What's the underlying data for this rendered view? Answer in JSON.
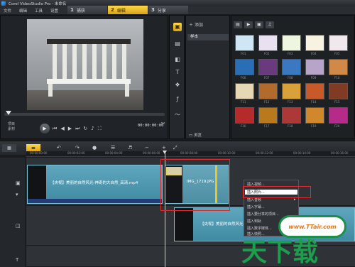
{
  "window": {
    "title": "Corel VideoStudio Pro - 未命名"
  },
  "menu": [
    "文件",
    "编辑",
    "工具",
    "设置"
  ],
  "steps": [
    {
      "num": "1",
      "label": "捕获"
    },
    {
      "num": "2",
      "label": "编辑"
    },
    {
      "num": "3",
      "label": "分享"
    }
  ],
  "player": {
    "project_label": "项目",
    "clip_label": "素材",
    "timecode": "00:00:00:00"
  },
  "library": {
    "add_label": "添加",
    "sample_folder": "样本",
    "browse_label": "浏览",
    "thumbs": [
      {
        "label": "F01",
        "color": "#cfe7f5"
      },
      {
        "label": "F02",
        "color": "#e9e0f0"
      },
      {
        "label": "F03",
        "color": "#eef6df"
      },
      {
        "label": "F04",
        "color": "#f7f3e0"
      },
      {
        "label": "F05",
        "color": "#f0e8ec"
      },
      {
        "label": "F06",
        "color": "#2a6fb5"
      },
      {
        "label": "F07",
        "color": "#6a3a7e"
      },
      {
        "label": "F08",
        "color": "#3a78c2"
      },
      {
        "label": "F09",
        "color": "#b9a4c9"
      },
      {
        "label": "F10",
        "color": "#d1894a"
      },
      {
        "label": "F11",
        "color": "#e7d8b5"
      },
      {
        "label": "F12",
        "color": "#b26b2c"
      },
      {
        "label": "F13",
        "color": "#d9a13a"
      },
      {
        "label": "F14",
        "color": "#c85a2a"
      },
      {
        "label": "F15",
        "color": "#7f3b24"
      },
      {
        "label": "F16",
        "color": "#b52a2a"
      },
      {
        "label": "F17",
        "color": "#b87a1c"
      },
      {
        "label": "F18",
        "color": "#ad3838"
      },
      {
        "label": "F19",
        "color": "#d0882a"
      },
      {
        "label": "F20",
        "color": "#b62a8a"
      }
    ]
  },
  "ruler": [
    "00:00:00:00",
    "00:00:02:00",
    "00:00:04:00",
    "00:00:06:00",
    "00:00:08:00",
    "00:00:10:00",
    "00:00:12:00",
    "00:00:14:00",
    "00:00:16:00"
  ],
  "timeline": {
    "clip1_name": "【央视】美丽的自然风光-神奇的大自然_高清.mp4",
    "clip2_name": "IMG_1719.JPG",
    "clip3_name": "【央视】美丽的自然风光-神奇的大自然_高清.mp4"
  },
  "context_menu": {
    "items": [
      "插入视频...",
      "插入照片...",
      "插入音频",
      "插入字幕...",
      "插入要分享的项目...",
      "插入到轨",
      "插入数字媒体...",
      "插入快照..."
    ],
    "highlighted_index": 1
  },
  "watermark": {
    "badge": "www.TTair.com",
    "logo": "天下载"
  },
  "colors": {
    "accent": "#ffd64a",
    "clip": "#4f97ae",
    "highlight_box": "#e2282a",
    "brand_green": "#1c9e4d"
  }
}
